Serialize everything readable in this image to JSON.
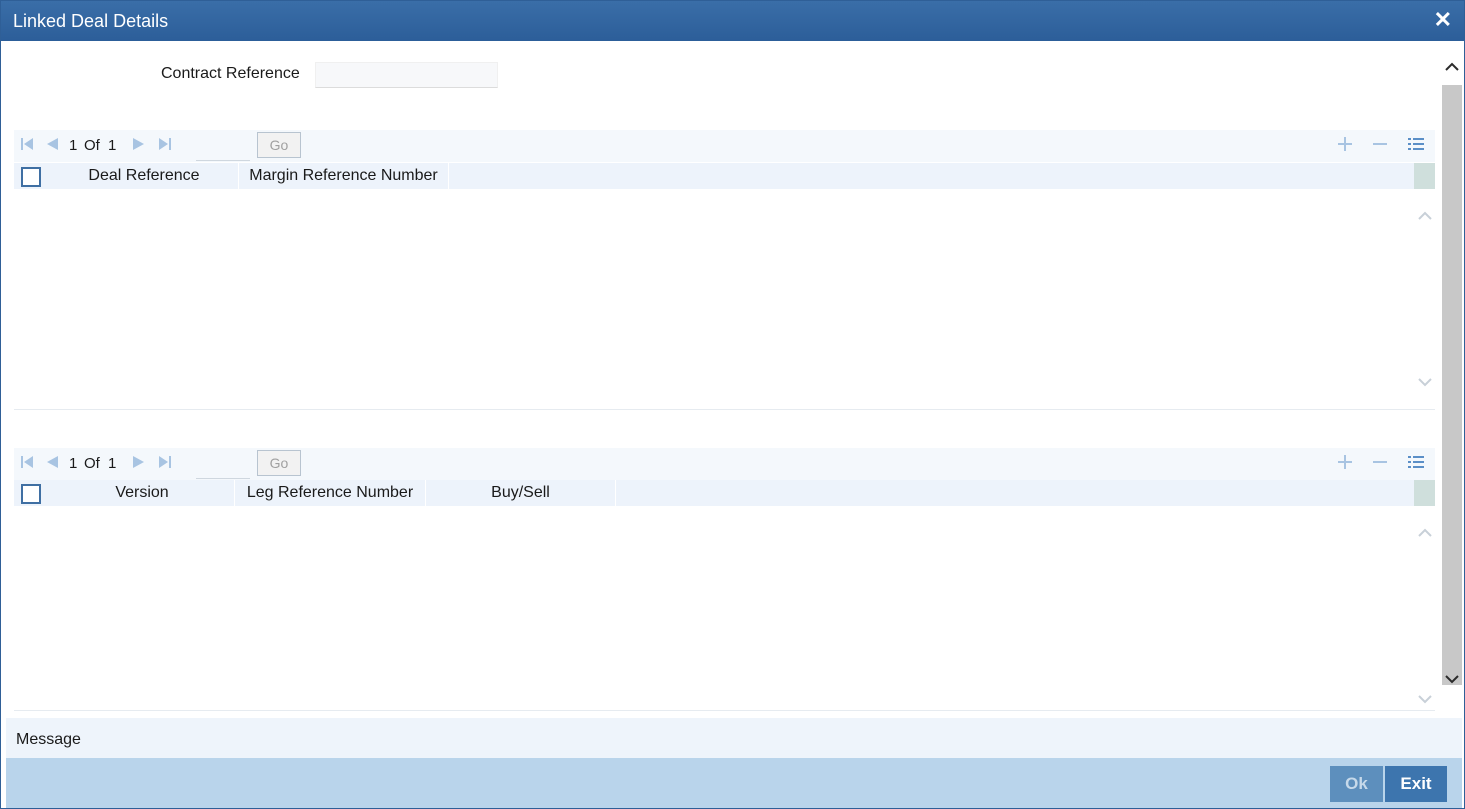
{
  "window": {
    "title": "Linked Deal Details",
    "close_glyph": "✕"
  },
  "form": {
    "contract_reference_label": "Contract Reference",
    "contract_reference_value": ""
  },
  "grid1": {
    "pager": {
      "current": "1",
      "of_label": "Of",
      "total": "1",
      "go_label": "Go",
      "goto_value": ""
    },
    "columns": [
      "Deal Reference",
      "Margin Reference Number"
    ],
    "rows": []
  },
  "grid2": {
    "pager": {
      "current": "1",
      "of_label": "Of",
      "total": "1",
      "go_label": "Go",
      "goto_value": ""
    },
    "columns": [
      "Version",
      "Leg Reference Number",
      "Buy/Sell"
    ],
    "rows": []
  },
  "message": {
    "label": "Message"
  },
  "footer": {
    "ok_label": "Ok",
    "exit_label": "Exit"
  },
  "icons": {
    "first": "first-page-icon",
    "prev": "previous-page-icon",
    "next": "next-page-icon",
    "last": "last-page-icon",
    "add": "add-row-icon",
    "delete": "delete-row-icon",
    "view": "single-view-icon"
  },
  "colors": {
    "titlebar": "#2c5e99",
    "accent": "#3d75ae",
    "pager_bg": "#f4f8fc",
    "header_bg": "#edf3fb",
    "footer_bg": "#b9d4eb"
  }
}
